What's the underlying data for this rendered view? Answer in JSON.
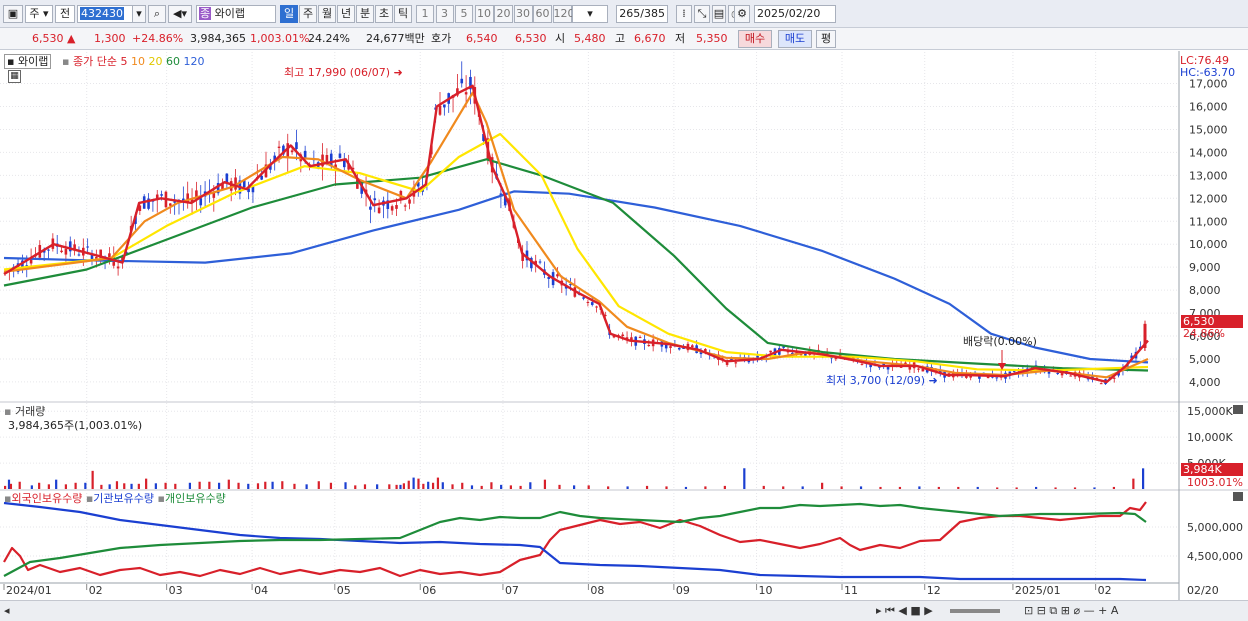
{
  "toolbar": {
    "type_label": "주",
    "prev_label": "전",
    "code_value": "432430",
    "stock_name": "와이랩",
    "periods": [
      "일",
      "주",
      "월",
      "년",
      "분",
      "초",
      "틱"
    ],
    "active_period": "일",
    "intervals": [
      "1",
      "3",
      "5",
      "10",
      "20",
      "30",
      "60",
      "120"
    ],
    "count_value": "265",
    "count_total": "/385",
    "date_value": "2025/02/20"
  },
  "quote": {
    "price": "6,530",
    "change": "1,300",
    "change_pct": "+24.86%",
    "volume": "3,984,365",
    "volume_ratio": "1,003.01%",
    "turnover": "24.24%",
    "amount": "24,677백만",
    "hoga_label": "호가",
    "ask": "6,540",
    "bid": "6,530",
    "open_label": "시",
    "open": "5,480",
    "high_label": "고",
    "high": "6,670",
    "low_label": "저",
    "low": "5,350",
    "buy_label": "매수",
    "sell_label": "매도",
    "avg_label": "평"
  },
  "price_panel": {
    "stock_tag": "와이랩",
    "ma_title": "종가 단순",
    "ma_periods": [
      "5",
      "10",
      "20",
      "60",
      "120"
    ],
    "lc_label": "LC:76.49",
    "hc_label": "HC:-63.70",
    "high_annotation": "최고 17,990 (06/07)",
    "low_annotation": "최저 3,700 (12/09)",
    "dividend_annotation": "배당락(0.00%)",
    "last_price_tag": "6,530",
    "last_pct_tag": "24.86%",
    "y_ticks": [
      "17,000",
      "16,000",
      "15,000",
      "14,000",
      "13,000",
      "12,000",
      "11,000",
      "10,000",
      "9,000",
      "8,000",
      "7,000",
      "6,000",
      "5,000",
      "4,000"
    ]
  },
  "volume_panel": {
    "title": "거래량",
    "value_label": "3,984,365주(1,003.01%)",
    "y_ticks": [
      "15,000K",
      "10,000K",
      "5,000K"
    ],
    "last_tag": "3,984K",
    "last_pct_tag": "1003.01%"
  },
  "holdings_panel": {
    "legend": [
      "외국인보유수량",
      "기관보유수량",
      "개인보유수량"
    ],
    "y_ticks": [
      "5,000,000",
      "4,500,000"
    ]
  },
  "x_axis": {
    "labels": [
      "2024/01",
      "02",
      "03",
      "04",
      "05",
      "06",
      "07",
      "08",
      "09",
      "10",
      "11",
      "12",
      "2025/01",
      "02"
    ],
    "right_label": "02/20"
  },
  "colors": {
    "ma5": "#d8202a",
    "ma10": "#f08a1e",
    "ma20": "#ffe600",
    "ma60": "#1e8c3a",
    "ma120": "#2e5fd8",
    "up": "#d8202a",
    "down": "#1b3fd1"
  },
  "chart_data": {
    "type": "line",
    "title": "",
    "ylim": [
      3300,
      18200
    ],
    "series": [
      {
        "name": "5",
        "points": [
          [
            "2024-01-02",
            8700
          ],
          [
            "2024-01-20",
            10000
          ],
          [
            "2024-02-05",
            9500
          ],
          [
            "2024-02-14",
            9200
          ],
          [
            "2024-02-20",
            11800
          ],
          [
            "2024-02-28",
            12000
          ],
          [
            "2024-03-10",
            11800
          ],
          [
            "2024-03-22",
            12700
          ],
          [
            "2024-03-30",
            12400
          ],
          [
            "2024-04-08",
            13500
          ],
          [
            "2024-04-15",
            14300
          ],
          [
            "2024-04-22",
            13400
          ],
          [
            "2024-05-05",
            13700
          ],
          [
            "2024-05-15",
            11700
          ],
          [
            "2024-05-27",
            12000
          ],
          [
            "2024-06-03",
            12600
          ],
          [
            "2024-06-07",
            16000
          ],
          [
            "2024-06-15",
            16600
          ],
          [
            "2024-06-20",
            16900
          ],
          [
            "2024-06-27",
            13400
          ],
          [
            "2024-07-03",
            11800
          ],
          [
            "2024-07-08",
            9600
          ],
          [
            "2024-07-18",
            8600
          ],
          [
            "2024-07-28",
            7900
          ],
          [
            "2024-08-05",
            7400
          ],
          [
            "2024-08-09",
            6100
          ],
          [
            "2024-08-16",
            5800
          ],
          [
            "2024-08-30",
            5650
          ],
          [
            "2024-09-10",
            5400
          ],
          [
            "2024-09-20",
            4900
          ],
          [
            "2024-10-02",
            5000
          ],
          [
            "2024-10-10",
            5400
          ],
          [
            "2024-10-25",
            5200
          ],
          [
            "2024-11-05",
            4950
          ],
          [
            "2024-11-15",
            4700
          ],
          [
            "2024-11-28",
            4700
          ],
          [
            "2024-12-09",
            4300
          ],
          [
            "2024-12-16",
            4300
          ],
          [
            "2024-12-30",
            4250
          ],
          [
            "2025-01-10",
            4600
          ],
          [
            "2025-01-22",
            4400
          ],
          [
            "2025-02-05",
            4000
          ],
          [
            "2025-02-12",
            4700
          ],
          [
            "2025-02-20",
            5800
          ]
        ]
      },
      {
        "name": "10",
        "points": [
          [
            "2024-01-02",
            8800
          ],
          [
            "2024-02-10",
            9400
          ],
          [
            "2024-02-22",
            11000
          ],
          [
            "2024-03-05",
            11800
          ],
          [
            "2024-03-25",
            12500
          ],
          [
            "2024-04-12",
            13800
          ],
          [
            "2024-04-25",
            13700
          ],
          [
            "2024-05-10",
            12800
          ],
          [
            "2024-05-27",
            12000
          ],
          [
            "2024-06-05",
            13600
          ],
          [
            "2024-06-20",
            16600
          ],
          [
            "2024-06-25",
            15300
          ],
          [
            "2024-07-05",
            11500
          ],
          [
            "2024-07-22",
            8600
          ],
          [
            "2024-08-05",
            7500
          ],
          [
            "2024-08-15",
            6400
          ],
          [
            "2024-08-30",
            5700
          ],
          [
            "2024-09-20",
            5050
          ],
          [
            "2024-10-05",
            5000
          ],
          [
            "2024-10-20",
            5300
          ],
          [
            "2024-11-10",
            4900
          ],
          [
            "2024-11-28",
            4700
          ],
          [
            "2024-12-12",
            4400
          ],
          [
            "2024-12-30",
            4300
          ],
          [
            "2025-01-15",
            4500
          ],
          [
            "2025-02-05",
            4200
          ],
          [
            "2025-02-20",
            5000
          ]
        ]
      },
      {
        "name": "20",
        "points": [
          [
            "2024-01-02",
            8900
          ],
          [
            "2024-02-10",
            9400
          ],
          [
            "2024-03-01",
            10800
          ],
          [
            "2024-03-25",
            12200
          ],
          [
            "2024-04-20",
            13400
          ],
          [
            "2024-05-10",
            13100
          ],
          [
            "2024-06-01",
            12300
          ],
          [
            "2024-06-15",
            13800
          ],
          [
            "2024-06-30",
            14800
          ],
          [
            "2024-07-15",
            13000
          ],
          [
            "2024-07-28",
            9800
          ],
          [
            "2024-08-12",
            7300
          ],
          [
            "2024-08-30",
            6100
          ],
          [
            "2024-09-20",
            5300
          ],
          [
            "2024-10-10",
            5100
          ],
          [
            "2024-11-05",
            5100
          ],
          [
            "2024-11-28",
            4900
          ],
          [
            "2024-12-20",
            4550
          ],
          [
            "2025-01-15",
            4500
          ],
          [
            "2025-02-20",
            4650
          ]
        ]
      },
      {
        "name": "60",
        "points": [
          [
            "2024-01-02",
            8200
          ],
          [
            "2024-02-01",
            8900
          ],
          [
            "2024-03-01",
            10200
          ],
          [
            "2024-04-01",
            11600
          ],
          [
            "2024-05-01",
            12600
          ],
          [
            "2024-06-01",
            12900
          ],
          [
            "2024-06-25",
            13700
          ],
          [
            "2024-07-15",
            13000
          ],
          [
            "2024-08-10",
            11800
          ],
          [
            "2024-09-01",
            9500
          ],
          [
            "2024-09-20",
            7200
          ],
          [
            "2024-10-05",
            5700
          ],
          [
            "2024-10-25",
            5300
          ],
          [
            "2024-11-20",
            5000
          ],
          [
            "2024-12-20",
            4800
          ],
          [
            "2025-01-20",
            4600
          ],
          [
            "2025-02-20",
            4500
          ]
        ]
      },
      {
        "name": "120",
        "points": [
          [
            "2024-01-02",
            9400
          ],
          [
            "2024-02-01",
            9300
          ],
          [
            "2024-03-15",
            9200
          ],
          [
            "2024-04-15",
            9600
          ],
          [
            "2024-05-15",
            10600
          ],
          [
            "2024-06-15",
            11500
          ],
          [
            "2024-07-05",
            12300
          ],
          [
            "2024-07-25",
            12200
          ],
          [
            "2024-08-25",
            11600
          ],
          [
            "2024-09-25",
            10800
          ],
          [
            "2024-10-25",
            9700
          ],
          [
            "2024-11-20",
            8500
          ],
          [
            "2024-12-10",
            7400
          ],
          [
            "2024-12-25",
            6100
          ],
          [
            "2025-01-10",
            5500
          ],
          [
            "2025-01-30",
            5000
          ],
          [
            "2025-02-20",
            4850
          ]
        ]
      }
    ],
    "volume_k": [
      [
        0.0,
        600
      ],
      [
        0.8,
        1800
      ],
      [
        1.2,
        1000
      ],
      [
        3.0,
        1400
      ],
      [
        5.5,
        700
      ],
      [
        7.0,
        1200
      ],
      [
        9.0,
        900
      ],
      [
        10.5,
        1800
      ],
      [
        12.5,
        900
      ],
      [
        14.5,
        1200
      ],
      [
        16.5,
        1200
      ],
      [
        18.0,
        3500
      ],
      [
        19.8,
        800
      ],
      [
        21.5,
        900
      ],
      [
        23.0,
        1500
      ],
      [
        24.5,
        1100
      ],
      [
        26.0,
        1000
      ],
      [
        27.5,
        1000
      ],
      [
        29.0,
        2000
      ],
      [
        31.0,
        1100
      ],
      [
        33.0,
        1200
      ],
      [
        35.0,
        1000
      ],
      [
        38.0,
        1200
      ],
      [
        40.0,
        1400
      ],
      [
        42.0,
        1400
      ],
      [
        44.0,
        1200
      ],
      [
        46.0,
        1800
      ],
      [
        48.0,
        1200
      ],
      [
        50.0,
        1000
      ],
      [
        52.0,
        1100
      ],
      [
        53.5,
        1400
      ],
      [
        55.0,
        1400
      ],
      [
        57.0,
        1500
      ],
      [
        59.5,
        1000
      ],
      [
        62.0,
        900
      ],
      [
        64.5,
        1500
      ],
      [
        67.0,
        1200
      ],
      [
        70.0,
        1300
      ],
      [
        72.0,
        700
      ],
      [
        74.0,
        900
      ],
      [
        76.5,
        900
      ],
      [
        79.0,
        900
      ],
      [
        80.5,
        800
      ],
      [
        81.3,
        800
      ],
      [
        82.0,
        1100
      ],
      [
        83.0,
        1600
      ],
      [
        84.0,
        2200
      ],
      [
        85.0,
        2000
      ],
      [
        86.0,
        1000
      ],
      [
        87.0,
        1400
      ],
      [
        88.0,
        1200
      ],
      [
        89.0,
        2200
      ],
      [
        90.0,
        1300
      ],
      [
        92.0,
        900
      ],
      [
        94.0,
        1200
      ],
      [
        96.0,
        700
      ],
      [
        98.0,
        600
      ],
      [
        100.0,
        1300
      ],
      [
        102.0,
        800
      ],
      [
        104.0,
        700
      ],
      [
        106.0,
        600
      ],
      [
        108.0,
        1300
      ],
      [
        111.0,
        1800
      ],
      [
        114.0,
        800
      ],
      [
        117.0,
        700
      ],
      [
        120.0,
        700
      ],
      [
        124.0,
        500
      ],
      [
        128.0,
        500
      ],
      [
        132.0,
        600
      ],
      [
        136.0,
        500
      ],
      [
        140.0,
        400
      ],
      [
        144.0,
        500
      ],
      [
        148.0,
        600
      ],
      [
        152.0,
        4000
      ],
      [
        156.0,
        600
      ],
      [
        160.0,
        500
      ],
      [
        164.0,
        500
      ],
      [
        168.0,
        1200
      ],
      [
        172.0,
        500
      ],
      [
        176.0,
        500
      ],
      [
        180.0,
        400
      ],
      [
        184.0,
        400
      ],
      [
        188.0,
        500
      ],
      [
        192.0,
        400
      ],
      [
        196.0,
        400
      ],
      [
        200.0,
        400
      ],
      [
        204.0,
        300
      ],
      [
        208.0,
        300
      ],
      [
        212.0,
        400
      ],
      [
        216.0,
        300
      ],
      [
        220.0,
        300
      ],
      [
        224.0,
        300
      ],
      [
        228.0,
        400
      ],
      [
        232.0,
        2000
      ],
      [
        234.0,
        3984
      ]
    ],
    "volume_ylim": [
      0,
      16000
    ]
  }
}
